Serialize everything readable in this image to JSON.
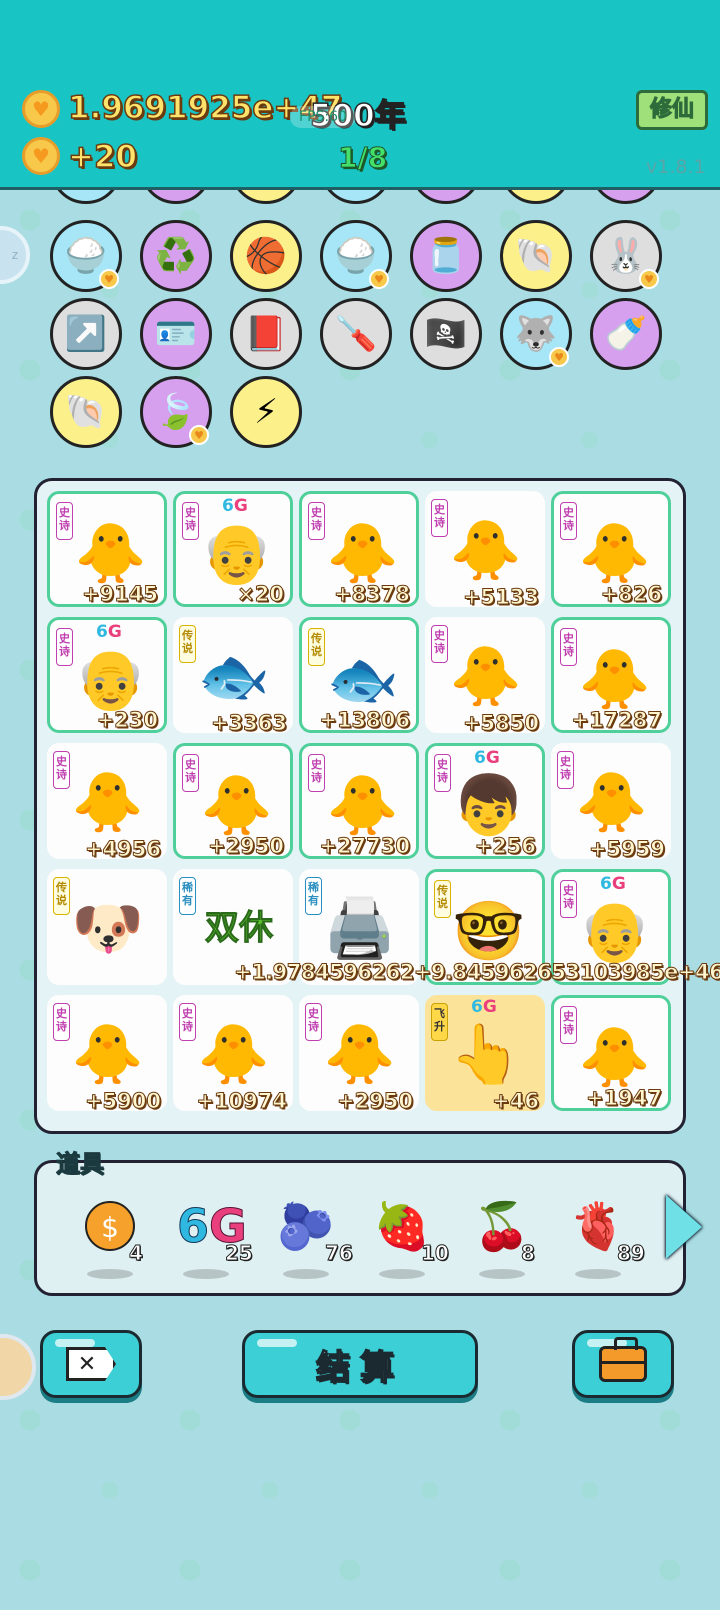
{
  "header": {
    "money": "1.9691925e+47",
    "year": "500年",
    "fps_label": "FPS:60",
    "income": "+20",
    "progress": "1/8",
    "mode_button": "修仙",
    "version": "v1.8.1"
  },
  "circle_items": [
    {
      "name": "rice-bowl",
      "icon": "🍚",
      "color": "#a6e6f6",
      "badge": true
    },
    {
      "name": "recycle",
      "icon": "♻️",
      "color": "#d7a0ef",
      "badge": false
    },
    {
      "name": "basketballs",
      "icon": "🏀",
      "color": "#fbf08a",
      "badge": false
    },
    {
      "name": "rice-bowl",
      "icon": "🍚",
      "color": "#a6e6f6",
      "badge": true
    },
    {
      "name": "jar",
      "icon": "🫙",
      "color": "#d7a0ef",
      "badge": false
    },
    {
      "name": "seashell",
      "icon": "🐚",
      "color": "#fbf08a",
      "badge": false
    },
    {
      "name": "rabbit",
      "icon": "🐰",
      "color": "#dedede",
      "badge": true
    },
    {
      "name": "arrow-card",
      "icon": "↗️",
      "color": "#dedede",
      "badge": false
    },
    {
      "name": "i-see-u-card",
      "icon": "🪪",
      "color": "#d7a0ef",
      "badge": false
    },
    {
      "name": "time-magazine",
      "icon": "📕",
      "color": "#dedede",
      "badge": false
    },
    {
      "name": "screwdriver",
      "icon": "🪛",
      "color": "#dedede",
      "badge": false
    },
    {
      "name": "eyepatch-coin",
      "icon": "🏴‍☠️",
      "color": "#dedede",
      "badge": false
    },
    {
      "name": "husky-dog",
      "icon": "🐺",
      "color": "#a6e6f6",
      "badge": true
    },
    {
      "name": "breast-pump",
      "icon": "🍼",
      "color": "#d7a0ef",
      "badge": false
    },
    {
      "name": "seashell",
      "icon": "🐚",
      "color": "#fbf08a",
      "badge": false
    },
    {
      "name": "leaf",
      "icon": "🍃",
      "color": "#d7a0ef",
      "badge": true
    },
    {
      "name": "lightning",
      "icon": "⚡",
      "color": "#fbf08a",
      "badge": false
    }
  ],
  "board": {
    "rows": [
      [
        {
          "tag": "史诗",
          "tag_type": "epic",
          "face": "🐥",
          "value": "+9145",
          "framed": true,
          "g6": false
        },
        {
          "tag": "史诗",
          "tag_type": "epic",
          "face": "👴",
          "value": "×20",
          "framed": true,
          "g6": true
        },
        {
          "tag": "史诗",
          "tag_type": "epic",
          "face": "🐥",
          "value": "+8378",
          "framed": true,
          "g6": false
        },
        {
          "tag": "史诗",
          "tag_type": "epic",
          "face": "🐥",
          "value": "+5133",
          "framed": false,
          "g6": false
        },
        {
          "tag": "史诗",
          "tag_type": "epic",
          "face": "🐥",
          "value": "+826",
          "framed": true,
          "g6": false
        }
      ],
      [
        {
          "tag": "史诗",
          "tag_type": "epic",
          "face": "👴",
          "value": "+230",
          "framed": true,
          "g6": true
        },
        {
          "tag": "传说",
          "tag_type": "legend",
          "face": "🐟",
          "value": "+3363",
          "framed": false,
          "g6": false
        },
        {
          "tag": "传说",
          "tag_type": "legend",
          "face": "🐟",
          "value": "+13806",
          "framed": true,
          "g6": false
        },
        {
          "tag": "史诗",
          "tag_type": "epic",
          "face": "🐥",
          "value": "+5850",
          "framed": false,
          "g6": false
        },
        {
          "tag": "史诗",
          "tag_type": "epic",
          "face": "🐥",
          "value": "+17287",
          "framed": true,
          "g6": false
        }
      ],
      [
        {
          "tag": "史诗",
          "tag_type": "epic",
          "face": "🐥",
          "value": "+4956",
          "framed": false,
          "g6": false
        },
        {
          "tag": "史诗",
          "tag_type": "epic",
          "face": "🐥",
          "value": "+2950",
          "framed": true,
          "g6": false
        },
        {
          "tag": "史诗",
          "tag_type": "epic",
          "face": "🐥",
          "value": "+27730",
          "framed": true,
          "g6": false
        },
        {
          "tag": "史诗",
          "tag_type": "epic",
          "face": "👦",
          "value": "+256",
          "framed": true,
          "g6": true
        },
        {
          "tag": "史诗",
          "tag_type": "epic",
          "face": "🐥",
          "value": "+5959",
          "framed": false,
          "g6": false
        }
      ],
      [
        {
          "tag": "传说",
          "tag_type": "legend",
          "face": "🐶",
          "value": "",
          "framed": false,
          "g6": false
        },
        {
          "tag": "稀有",
          "tag_type": "rare",
          "face": "双休",
          "value": "",
          "framed": false,
          "g6": false
        },
        {
          "tag": "稀有",
          "tag_type": "rare",
          "face": "🖨️",
          "value": "",
          "framed": false,
          "g6": false
        },
        {
          "tag": "传说",
          "tag_type": "legend",
          "face": "🤓",
          "value": "",
          "framed": true,
          "g6": false
        },
        {
          "tag": "史诗",
          "tag_type": "epic",
          "face": "👴",
          "value": "",
          "framed": true,
          "g6": true
        }
      ],
      [
        {
          "tag": "史诗",
          "tag_type": "epic",
          "face": "🐥",
          "value": "+5900",
          "framed": false,
          "g6": false
        },
        {
          "tag": "史诗",
          "tag_type": "epic",
          "face": "🐥",
          "value": "+10974",
          "framed": false,
          "g6": false
        },
        {
          "tag": "史诗",
          "tag_type": "epic",
          "face": "🐥",
          "value": "+2950",
          "framed": false,
          "g6": false
        },
        {
          "tag": "飞升",
          "tag_type": "ascend",
          "face": "👆",
          "value": "+46",
          "framed": false,
          "g6": true,
          "flying": true
        },
        {
          "tag": "史诗",
          "tag_type": "epic",
          "face": "🐥",
          "value": "+1947",
          "framed": true,
          "g6": false
        }
      ]
    ],
    "overflow_text": "+1.9784596262+9.845962653103985e+46"
  },
  "props": {
    "title": "道具",
    "items": [
      {
        "name": "dollar-coin",
        "icon": "💲",
        "count": "4"
      },
      {
        "name": "6g",
        "icon": "6G",
        "count": "25"
      },
      {
        "name": "blueberry",
        "icon": "🫐",
        "count": "76"
      },
      {
        "name": "strawberry",
        "icon": "🍓",
        "count": "10"
      },
      {
        "name": "bayberry",
        "icon": "🍒",
        "count": "8"
      },
      {
        "name": "liver",
        "icon": "🫀",
        "count": "89"
      }
    ]
  },
  "footer": {
    "settle_label": "结算"
  },
  "g6_text": {
    "six": "6",
    "g": "G"
  }
}
